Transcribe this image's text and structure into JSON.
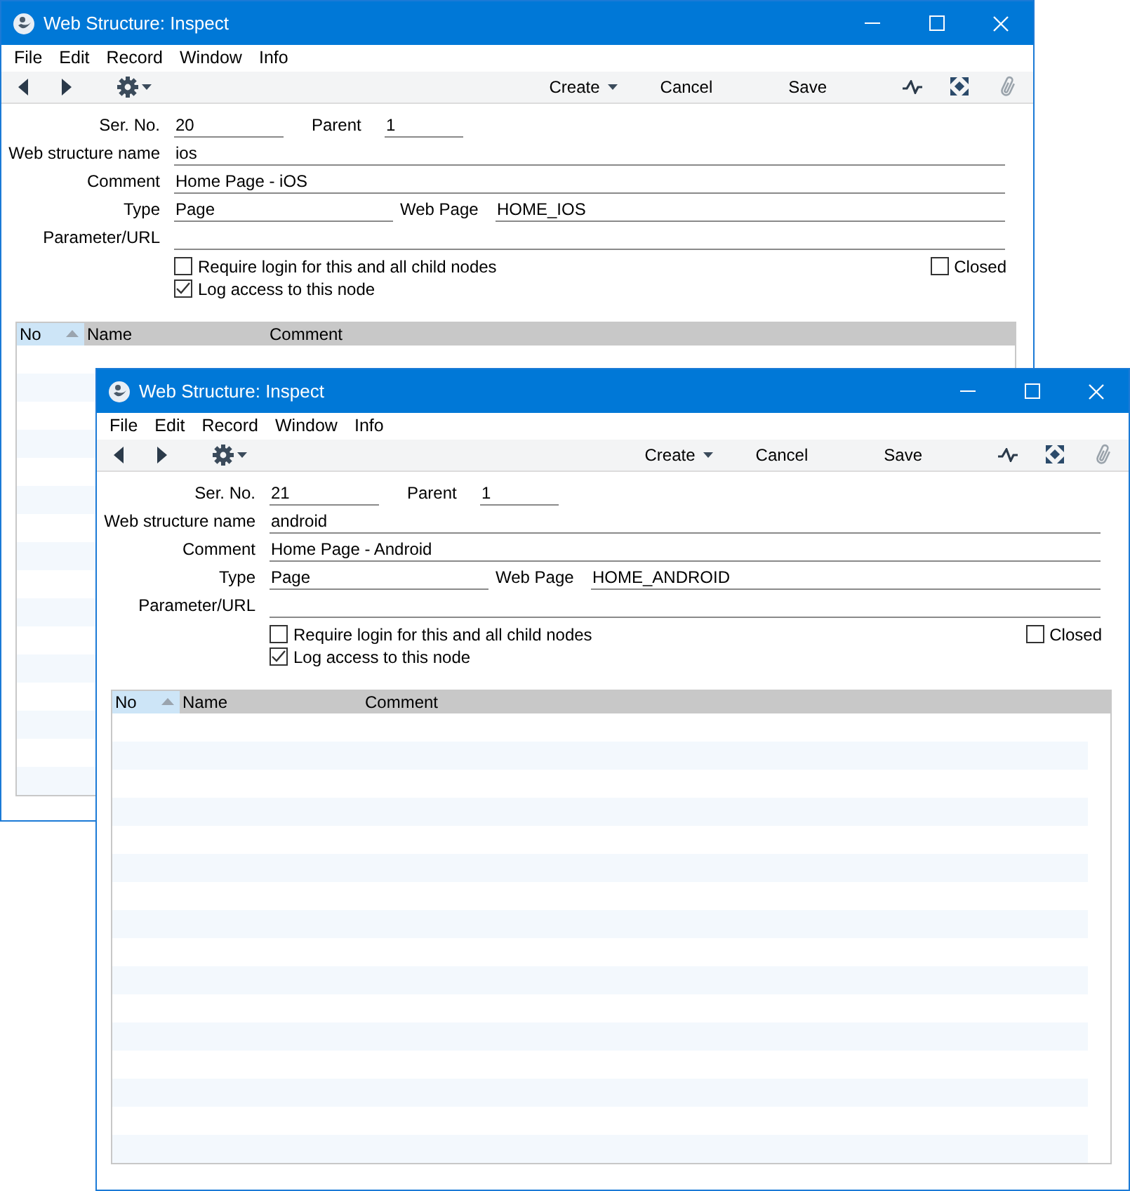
{
  "windows": [
    {
      "title": "Web Structure: Inspect",
      "menu": [
        "File",
        "Edit",
        "Record",
        "Window",
        "Info"
      ],
      "toolbar": {
        "create": "Create",
        "cancel": "Cancel",
        "save": "Save"
      },
      "fields": {
        "ser_no": {
          "label": "Ser. No.",
          "value": "20"
        },
        "parent": {
          "label": "Parent",
          "value": "1"
        },
        "name": {
          "label": "Web structure name",
          "value": "ios"
        },
        "comment": {
          "label": "Comment",
          "value": "Home Page - iOS"
        },
        "type": {
          "label": "Type",
          "value": "Page"
        },
        "web_page": {
          "label": "Web Page",
          "value": "HOME_IOS"
        },
        "parameter_url": {
          "label": "Parameter/URL"
        }
      },
      "checkboxes": [
        {
          "label": "Require login for this and all child nodes",
          "checked": false
        },
        {
          "label": "Log access to this node",
          "checked": true
        }
      ],
      "closed": {
        "label": "Closed",
        "checked": false
      },
      "table": {
        "columns": [
          {
            "label": "No",
            "sorted": true
          },
          {
            "label": "Name",
            "sorted": false
          },
          {
            "label": "Comment",
            "sorted": false
          }
        ]
      }
    },
    {
      "title": "Web Structure: Inspect",
      "menu": [
        "File",
        "Edit",
        "Record",
        "Window",
        "Info"
      ],
      "toolbar": {
        "create": "Create",
        "cancel": "Cancel",
        "save": "Save"
      },
      "fields": {
        "ser_no": {
          "label": "Ser. No.",
          "value": "21"
        },
        "parent": {
          "label": "Parent",
          "value": "1"
        },
        "name": {
          "label": "Web structure name",
          "value": "android"
        },
        "comment": {
          "label": "Comment",
          "value": "Home Page - Android"
        },
        "type": {
          "label": "Type",
          "value": "Page"
        },
        "web_page": {
          "label": "Web Page",
          "value": "HOME_ANDROID"
        },
        "parameter_url": {
          "label": "Parameter/URL"
        }
      },
      "checkboxes": [
        {
          "label": "Require login for this and all child nodes",
          "checked": false
        },
        {
          "label": "Log access to this node",
          "checked": true
        }
      ],
      "closed": {
        "label": "Closed",
        "checked": false
      },
      "table": {
        "columns": [
          {
            "label": "No",
            "sorted": true
          },
          {
            "label": "Name",
            "sorted": false
          },
          {
            "label": "Comment",
            "sorted": false
          }
        ]
      }
    }
  ]
}
